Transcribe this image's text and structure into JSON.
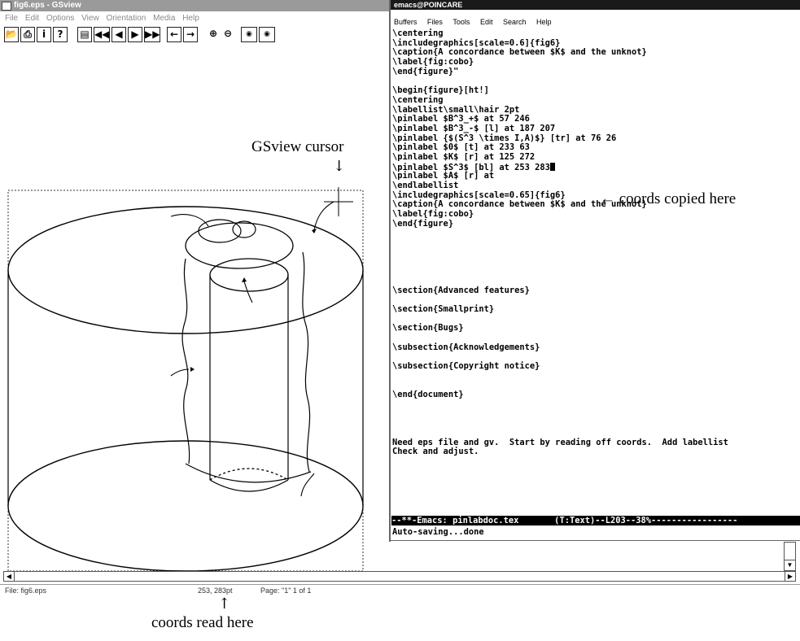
{
  "gsview": {
    "title": "fig6.eps - GSview",
    "menu": [
      "File",
      "Edit",
      "Options",
      "View",
      "Orientation",
      "Media",
      "Help"
    ],
    "status_file": "File: fig6.eps",
    "status_coords": "253, 283pt",
    "status_page": "Page: \"1\"  1 of 1"
  },
  "emacs": {
    "title": "emacs@POINCARE",
    "menu": [
      "Buffers",
      "Files",
      "Tools",
      "Edit",
      "Search",
      "Help"
    ],
    "lines": [
      "\\centering",
      "\\includegraphics[scale=0.6]{fig6}",
      "\\caption{A concordance between $K$ and the unknot}",
      "\\label{fig:cobo}",
      "\\end{figure}\"",
      "",
      "\\begin{figure}[ht!]",
      "\\centering",
      "\\labellist\\small\\hair 2pt",
      "\\pinlabel $B^3_+$ at 57 246",
      "\\pinlabel $B^3_-$ [l] at 187 207",
      "\\pinlabel {$(S^3 \\times I,A)$} [tr] at 76 26",
      "\\pinlabel $0$ [t] at 233 63",
      "\\pinlabel $K$ [r] at 125 272",
      "\\pinlabel $S^3$ [bl] at 253 283",
      "\\pinlabel $A$ [r] at",
      "\\endlabellist",
      "\\includegraphics[scale=0.65]{fig6}",
      "\\caption{A concordance between $K$ and the unknot}",
      "\\label{fig:cobo}",
      "\\end{figure}",
      "",
      "",
      "",
      "",
      "",
      "",
      "\\section{Advanced features}",
      "",
      "\\section{Smallprint}",
      "",
      "\\section{Bugs}",
      "",
      "\\subsection{Acknowledgements}",
      "",
      "\\subsection{Copyright notice}",
      "",
      "",
      "\\end{document}",
      "",
      "",
      "",
      "",
      "Need eps file and gv.  Start by reading off coords.  Add labellist",
      "Check and adjust."
    ],
    "mode_line": "--**-Emacs: pinlabdoc.tex       (T:Text)--L203--38%-----------------",
    "minibuffer": "Auto-saving...done"
  },
  "annotations": {
    "cursor_label": "GSview cursor",
    "copied_label": "← coords copied here",
    "read_label": "coords read here"
  }
}
